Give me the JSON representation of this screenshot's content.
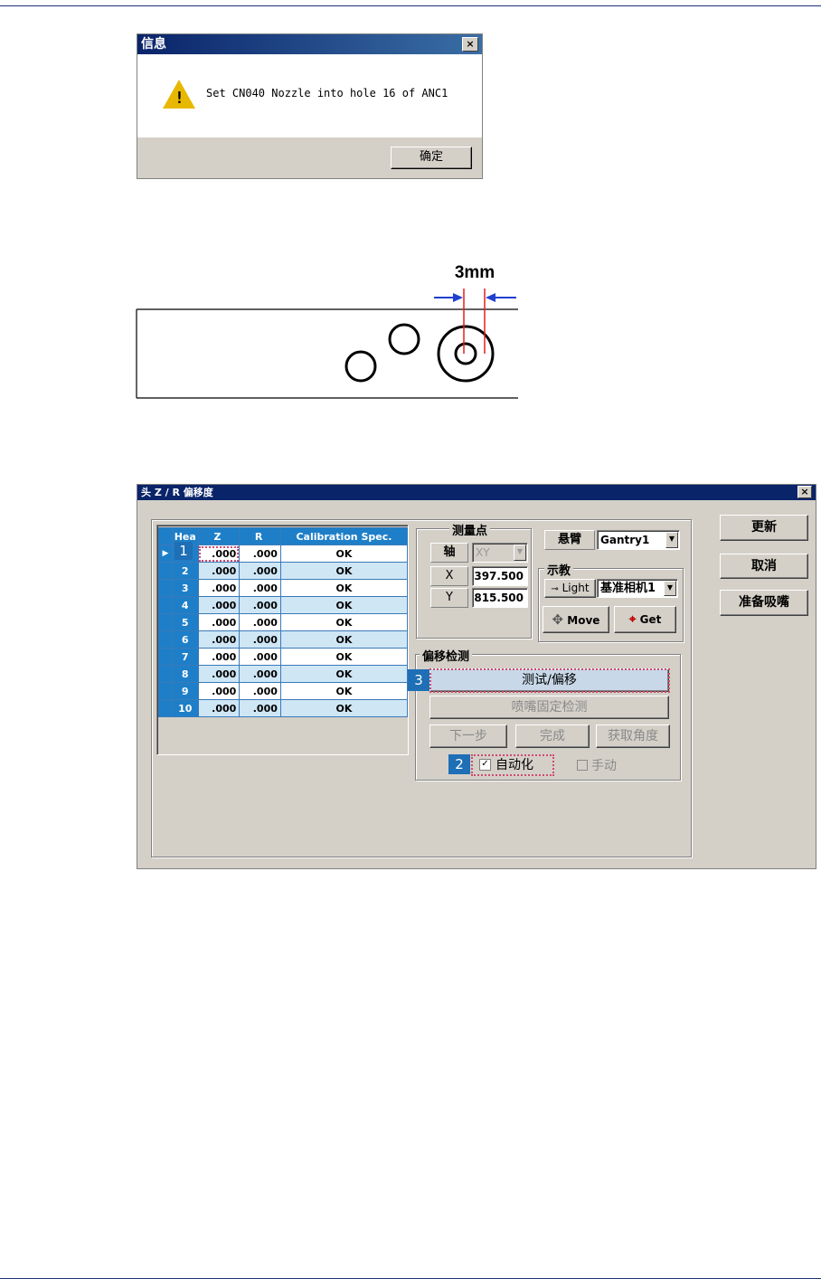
{
  "msgbox": {
    "title": "信息",
    "message": "Set CN040 Nozzle into hole 16 of ANC1",
    "ok_label": "确定",
    "close_glyph": "×",
    "icon": "warning-icon"
  },
  "diagram": {
    "dimension_label": "3mm"
  },
  "window": {
    "title": "头 Z / R 偏移度",
    "close_glyph": "×",
    "buttons": {
      "update": "更新",
      "cancel": "取消",
      "prepare_nozzle": "准备吸嘴"
    },
    "grid": {
      "headers": [
        "Hea",
        "Z",
        "R",
        "Calibration Spec."
      ],
      "rows": [
        {
          "head": "1",
          "z": ".000",
          "r": ".000",
          "spec": "OK"
        },
        {
          "head": "2",
          "z": ".000",
          "r": ".000",
          "spec": "OK"
        },
        {
          "head": "3",
          "z": ".000",
          "r": ".000",
          "spec": "OK"
        },
        {
          "head": "4",
          "z": ".000",
          "r": ".000",
          "spec": "OK"
        },
        {
          "head": "5",
          "z": ".000",
          "r": ".000",
          "spec": "OK"
        },
        {
          "head": "6",
          "z": ".000",
          "r": ".000",
          "spec": "OK"
        },
        {
          "head": "7",
          "z": ".000",
          "r": ".000",
          "spec": "OK"
        },
        {
          "head": "8",
          "z": ".000",
          "r": ".000",
          "spec": "OK"
        },
        {
          "head": "9",
          "z": ".000",
          "r": ".000",
          "spec": "OK"
        },
        {
          "head": "10",
          "z": ".000",
          "r": ".000",
          "spec": "OK"
        }
      ]
    },
    "measure": {
      "group_label": "测量点",
      "axis_label": "轴",
      "axis_value": "XY",
      "x_label": "X",
      "x_value": "397.500",
      "y_label": "Y",
      "y_value": "815.500"
    },
    "gantry": {
      "label": "悬臂",
      "value": "Gantry1"
    },
    "teach": {
      "group_label": "示教",
      "light_label": "Light",
      "camera_value": "基准相机1",
      "move_label": "Move",
      "get_label": "Get"
    },
    "offset_check": {
      "group_label": "偏移检测",
      "test_offset": "测试/偏移",
      "nozzle_fixed_check": "喷嘴固定检测",
      "next_step": "下一步",
      "finish": "完成",
      "get_angle": "获取角度",
      "auto_label": "自动化",
      "auto_checked": true,
      "manual_label": "手动",
      "manual_checked": false
    },
    "callouts": {
      "c1": "1",
      "c2": "2",
      "c3": "3"
    }
  },
  "colors": {
    "grid_header": "#1e7fc8",
    "callout": "#1e6fb5",
    "highlight_dash": "#d04a70",
    "dimension_line": "#e02020",
    "arrow": "#2040d0"
  }
}
